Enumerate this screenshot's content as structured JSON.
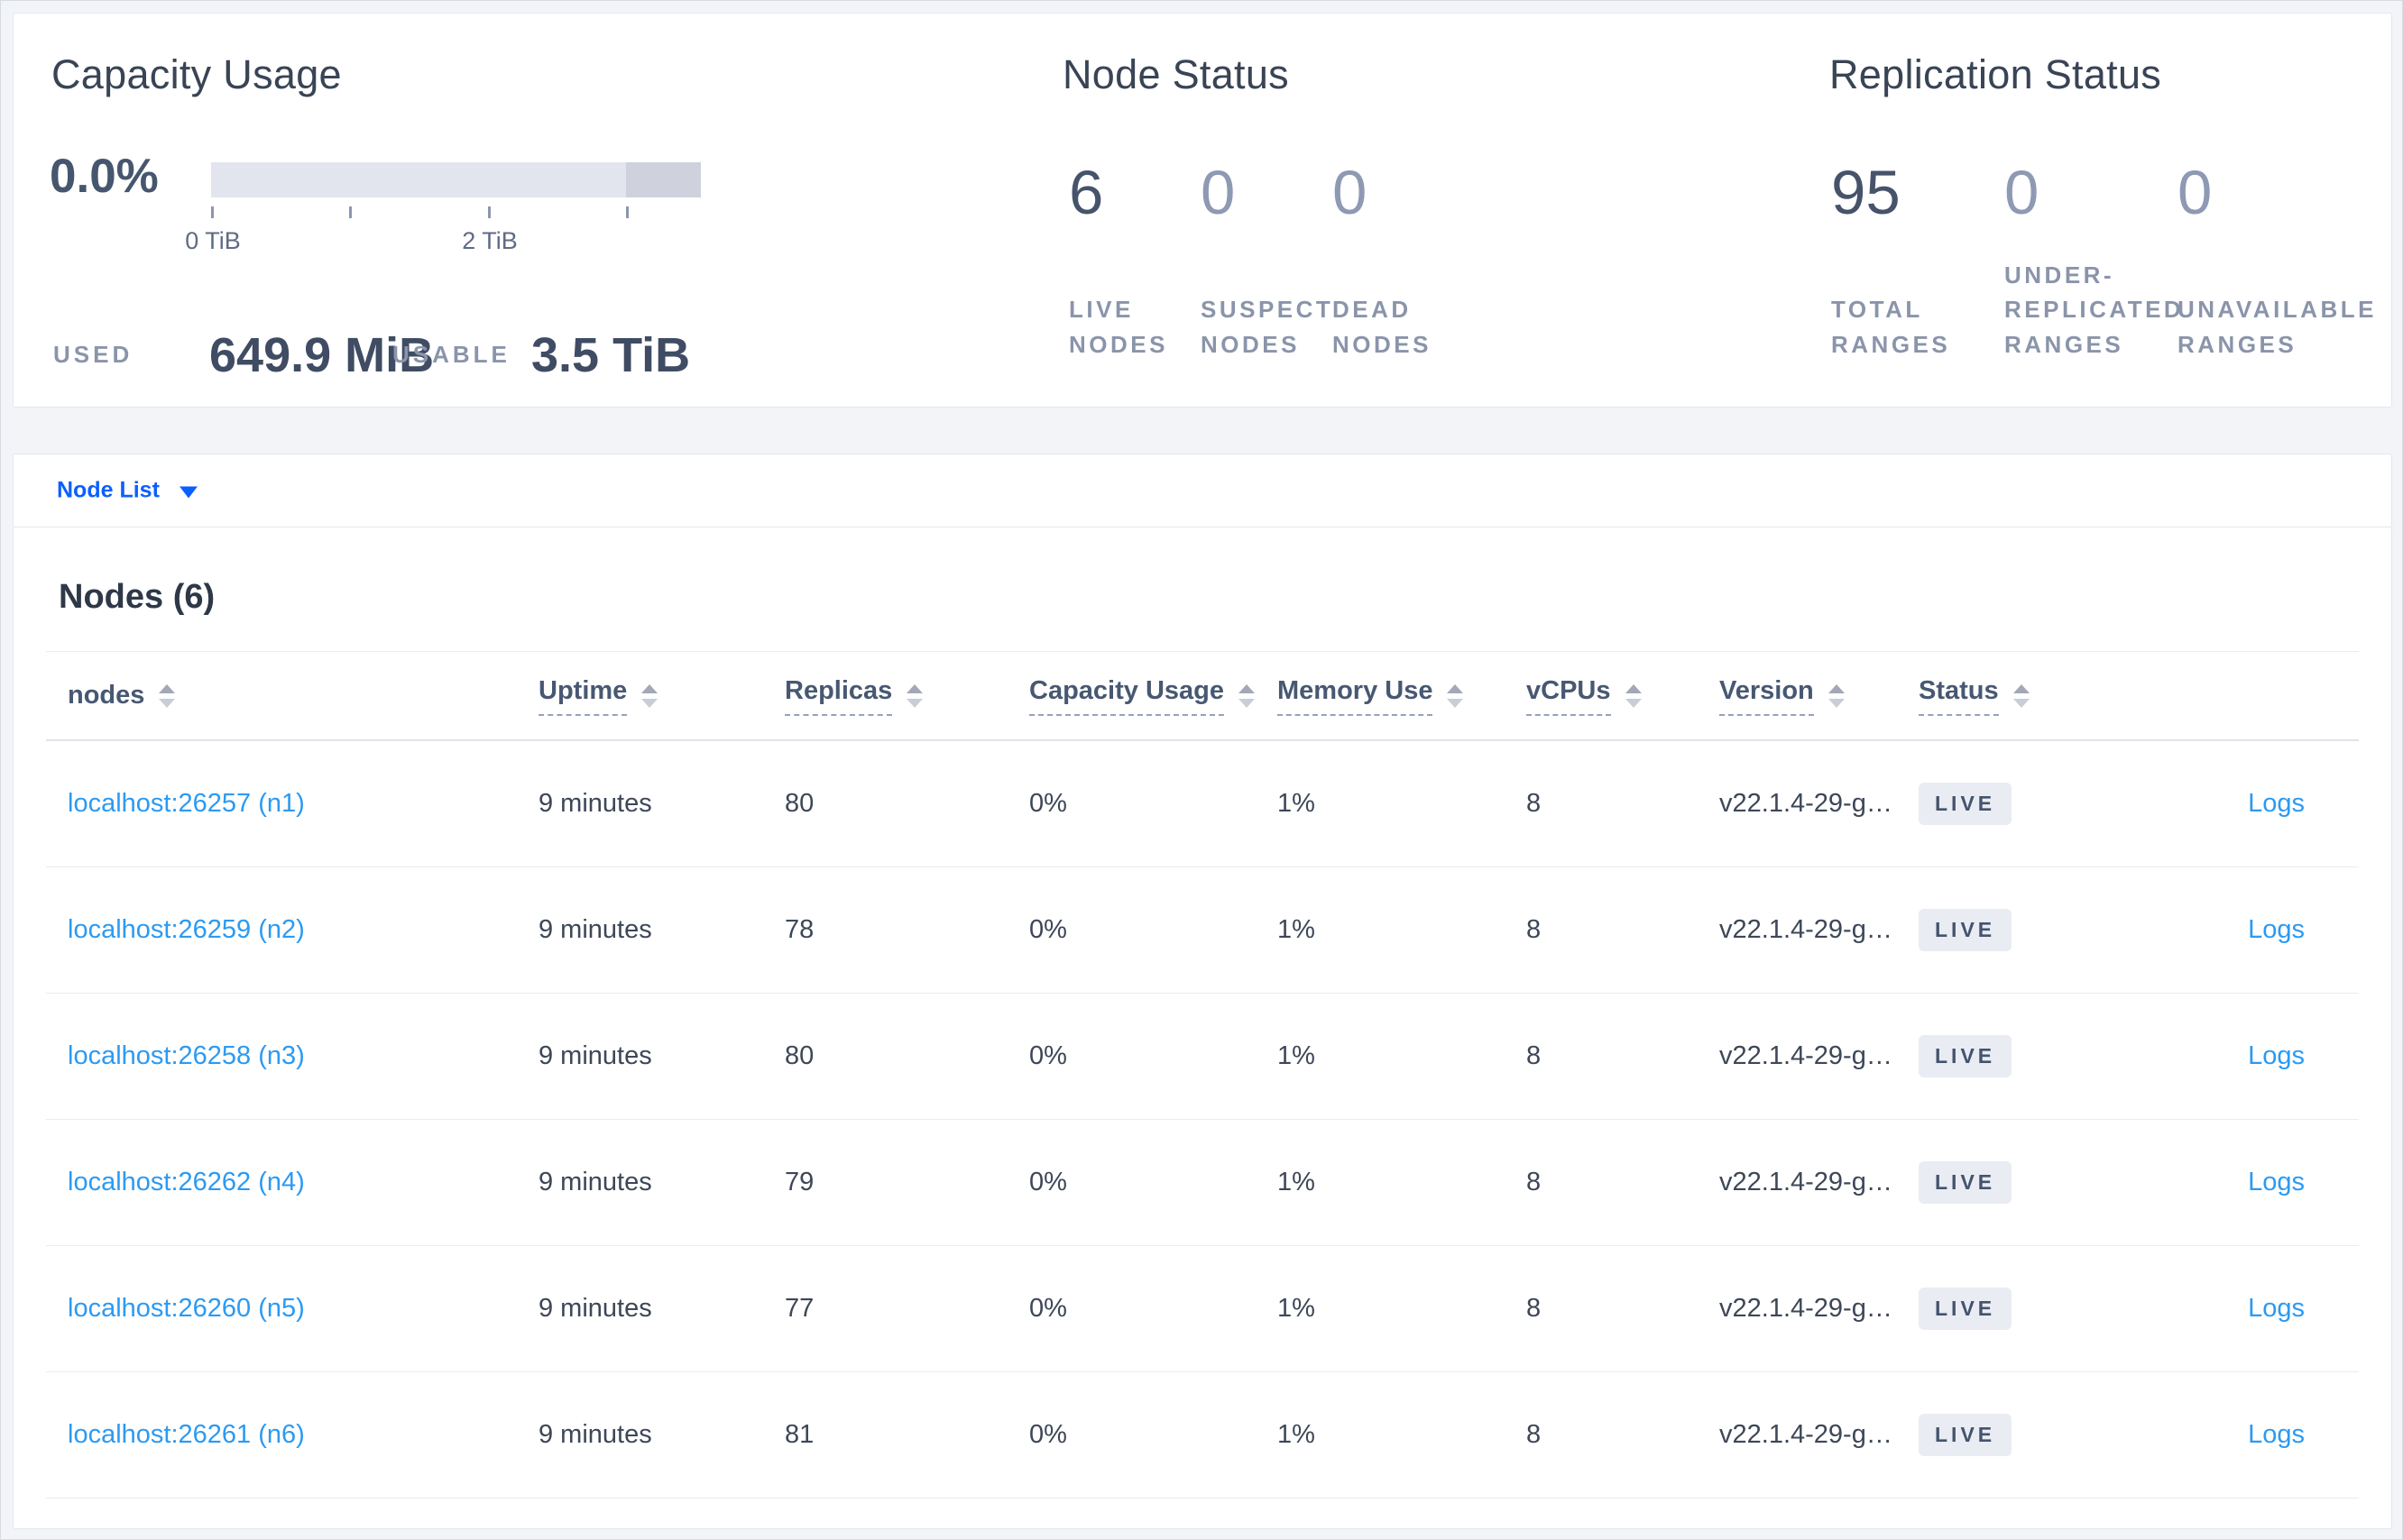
{
  "overview": {
    "capacity": {
      "title": "Capacity Usage",
      "percent": "0.0%",
      "tick_labels": [
        "0 TiB",
        "2 TiB"
      ],
      "bar": {
        "total_width_tib": 3.5,
        "used_fraction": 0.0,
        "reserved_fraction": 0.15,
        "track_color": "#e3e5ee",
        "reserved_color": "#cfd2dd"
      },
      "used_label": "USED",
      "used_value": "649.9 MiB",
      "usable_label": "USABLE",
      "usable_value": "3.5 TiB"
    },
    "node_status": {
      "title": "Node Status",
      "stats": [
        {
          "value": "6",
          "label": "LIVE NODES"
        },
        {
          "value": "0",
          "label": "SUSPECT NODES"
        },
        {
          "value": "0",
          "label": "DEAD NODES"
        }
      ]
    },
    "replication_status": {
      "title": "Replication Status",
      "stats": [
        {
          "value": "95",
          "label": "TOTAL RANGES"
        },
        {
          "value": "0",
          "label": "UNDER-REPLICATED RANGES"
        },
        {
          "value": "0",
          "label": "UNAVAILABLE RANGES"
        }
      ]
    }
  },
  "view_selector": {
    "label": "Node List"
  },
  "table": {
    "title": "Nodes (6)",
    "logs_label": "Logs",
    "columns": [
      {
        "label": "nodes"
      },
      {
        "label": "Uptime"
      },
      {
        "label": "Replicas"
      },
      {
        "label": "Capacity Usage"
      },
      {
        "label": "Memory Use"
      },
      {
        "label": "vCPUs"
      },
      {
        "label": "Version"
      },
      {
        "label": "Status"
      }
    ],
    "rows": [
      {
        "node": "localhost:26257 (n1)",
        "uptime": "9 minutes",
        "replicas": "80",
        "capacity": "0%",
        "memory": "1%",
        "vcpus": "8",
        "version": "v22.1.4-29-g…",
        "status": "LIVE"
      },
      {
        "node": "localhost:26259 (n2)",
        "uptime": "9 minutes",
        "replicas": "78",
        "capacity": "0%",
        "memory": "1%",
        "vcpus": "8",
        "version": "v22.1.4-29-g…",
        "status": "LIVE"
      },
      {
        "node": "localhost:26258 (n3)",
        "uptime": "9 minutes",
        "replicas": "80",
        "capacity": "0%",
        "memory": "1%",
        "vcpus": "8",
        "version": "v22.1.4-29-g…",
        "status": "LIVE"
      },
      {
        "node": "localhost:26262 (n4)",
        "uptime": "9 minutes",
        "replicas": "79",
        "capacity": "0%",
        "memory": "1%",
        "vcpus": "8",
        "version": "v22.1.4-29-g…",
        "status": "LIVE"
      },
      {
        "node": "localhost:26260 (n5)",
        "uptime": "9 minutes",
        "replicas": "77",
        "capacity": "0%",
        "memory": "1%",
        "vcpus": "8",
        "version": "v22.1.4-29-g…",
        "status": "LIVE"
      },
      {
        "node": "localhost:26261 (n6)",
        "uptime": "9 minutes",
        "replicas": "81",
        "capacity": "0%",
        "memory": "1%",
        "vcpus": "8",
        "version": "v22.1.4-29-g…",
        "status": "LIVE"
      }
    ]
  },
  "colors": {
    "page_bg": "#f2f4f8",
    "panel_bg": "#ffffff",
    "panel_border": "#e2e7ef",
    "heading_text": "#394455",
    "stat_number_dark": "#46536b",
    "stat_number_dim": "#8e99b3",
    "caps_label": "#8a94aa",
    "cell_text": "#3d4757",
    "header_text": "#475872",
    "primary_link_blue": "#0b5fff",
    "table_link_blue": "#2b9af3",
    "badge_bg": "#e9ecf2",
    "badge_text": "#44536e",
    "bar_track": "#e3e5ee",
    "bar_reserved": "#cfd2dd"
  }
}
